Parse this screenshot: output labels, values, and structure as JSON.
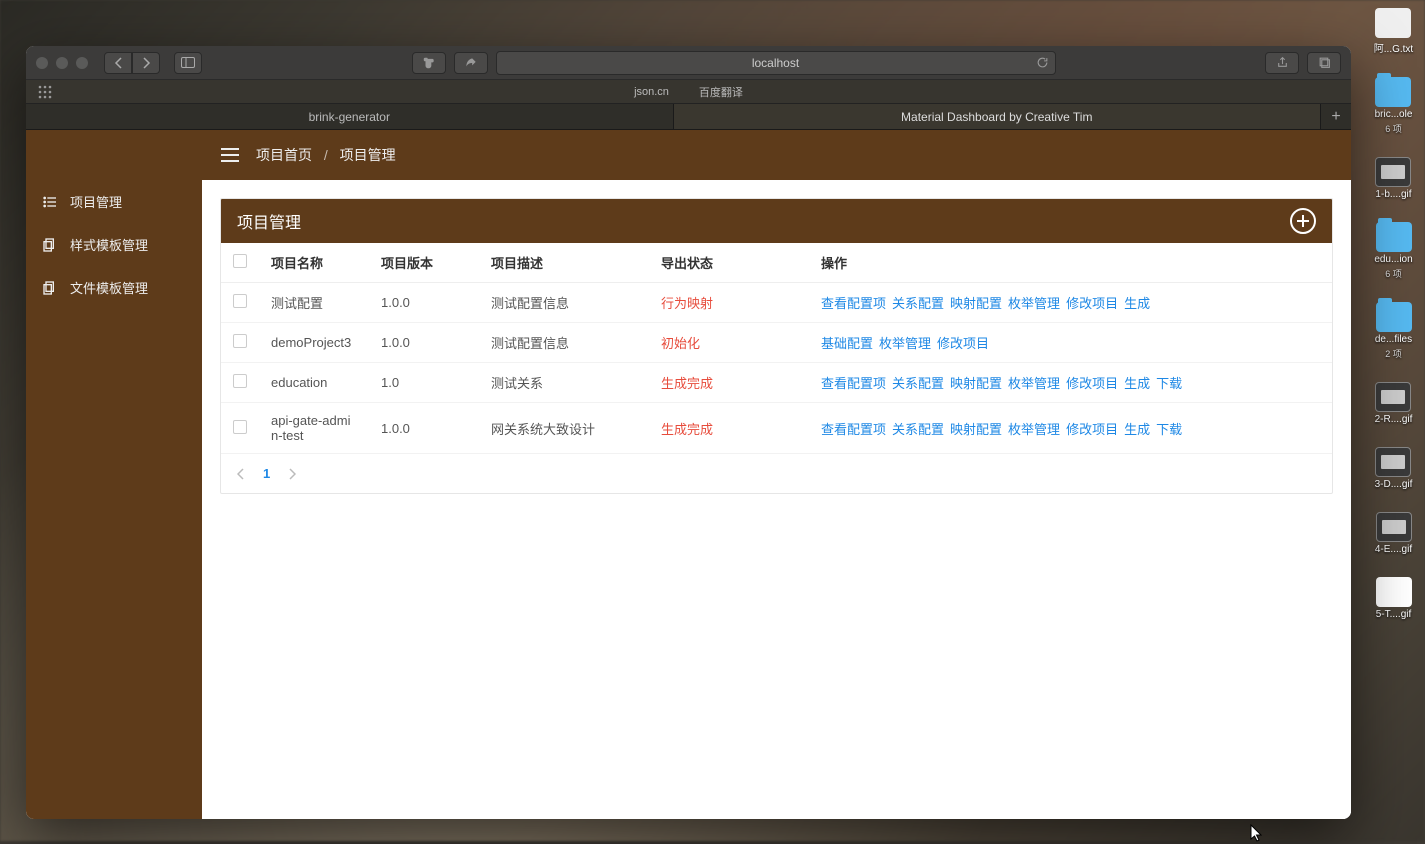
{
  "browser": {
    "url": "localhost",
    "favorites": [
      "json.cn",
      "百度翻译"
    ],
    "tabs": [
      {
        "title": "brink-generator",
        "active": false
      },
      {
        "title": "Material Dashboard by Creative Tim",
        "active": true
      }
    ]
  },
  "app": {
    "sidebar": {
      "items": [
        {
          "label": "项目管理",
          "icon": "list-icon"
        },
        {
          "label": "样式模板管理",
          "icon": "copy-icon"
        },
        {
          "label": "文件模板管理",
          "icon": "copy-icon"
        }
      ]
    },
    "breadcrumb": {
      "home": "项目首页",
      "sep": "/",
      "current": "项目管理"
    },
    "panel": {
      "title": "项目管理"
    },
    "table": {
      "columns": [
        "项目名称",
        "项目版本",
        "项目描述",
        "导出状态",
        "操作"
      ],
      "rows": [
        {
          "name": "测试配置",
          "version": "1.0.0",
          "desc": "测试配置信息",
          "status": "行为映射",
          "actions": [
            "查看配置项",
            "关系配置",
            "映射配置",
            "枚举管理",
            "修改项目",
            "生成"
          ]
        },
        {
          "name": "demoProject3",
          "version": "1.0.0",
          "desc": "测试配置信息",
          "status": "初始化",
          "actions": [
            "基础配置",
            "枚举管理",
            "修改项目"
          ]
        },
        {
          "name": "education",
          "version": "1.0",
          "desc": "测试关系",
          "status": "生成完成",
          "actions": [
            "查看配置项",
            "关系配置",
            "映射配置",
            "枚举管理",
            "修改项目",
            "生成",
            "下载"
          ]
        },
        {
          "name": "api-gate-admin-test",
          "version": "1.0.0",
          "desc": "网关系统大致设计",
          "status": "生成完成",
          "actions": [
            "查看配置项",
            "关系配置",
            "映射配置",
            "枚举管理",
            "修改项目",
            "生成",
            "下载"
          ]
        }
      ]
    },
    "pagination": {
      "current": "1"
    }
  },
  "desktop": {
    "icons": [
      {
        "type": "txt",
        "label": "阿...G.txt",
        "sub": ""
      },
      {
        "type": "folder",
        "label": "bric...ole",
        "sub": "6 项"
      },
      {
        "type": "gif",
        "label": "1-b....gif",
        "sub": ""
      },
      {
        "type": "folder",
        "label": "edu...ion",
        "sub": "6 项"
      },
      {
        "type": "folder",
        "label": "de...files",
        "sub": "2 项"
      },
      {
        "type": "gif",
        "label": "2-R....gif",
        "sub": ""
      },
      {
        "type": "gif",
        "label": "3-D....gif",
        "sub": ""
      },
      {
        "type": "gif",
        "label": "4-E....gif",
        "sub": ""
      },
      {
        "type": "gifdoc",
        "label": "5-T....gif",
        "sub": ""
      }
    ]
  }
}
